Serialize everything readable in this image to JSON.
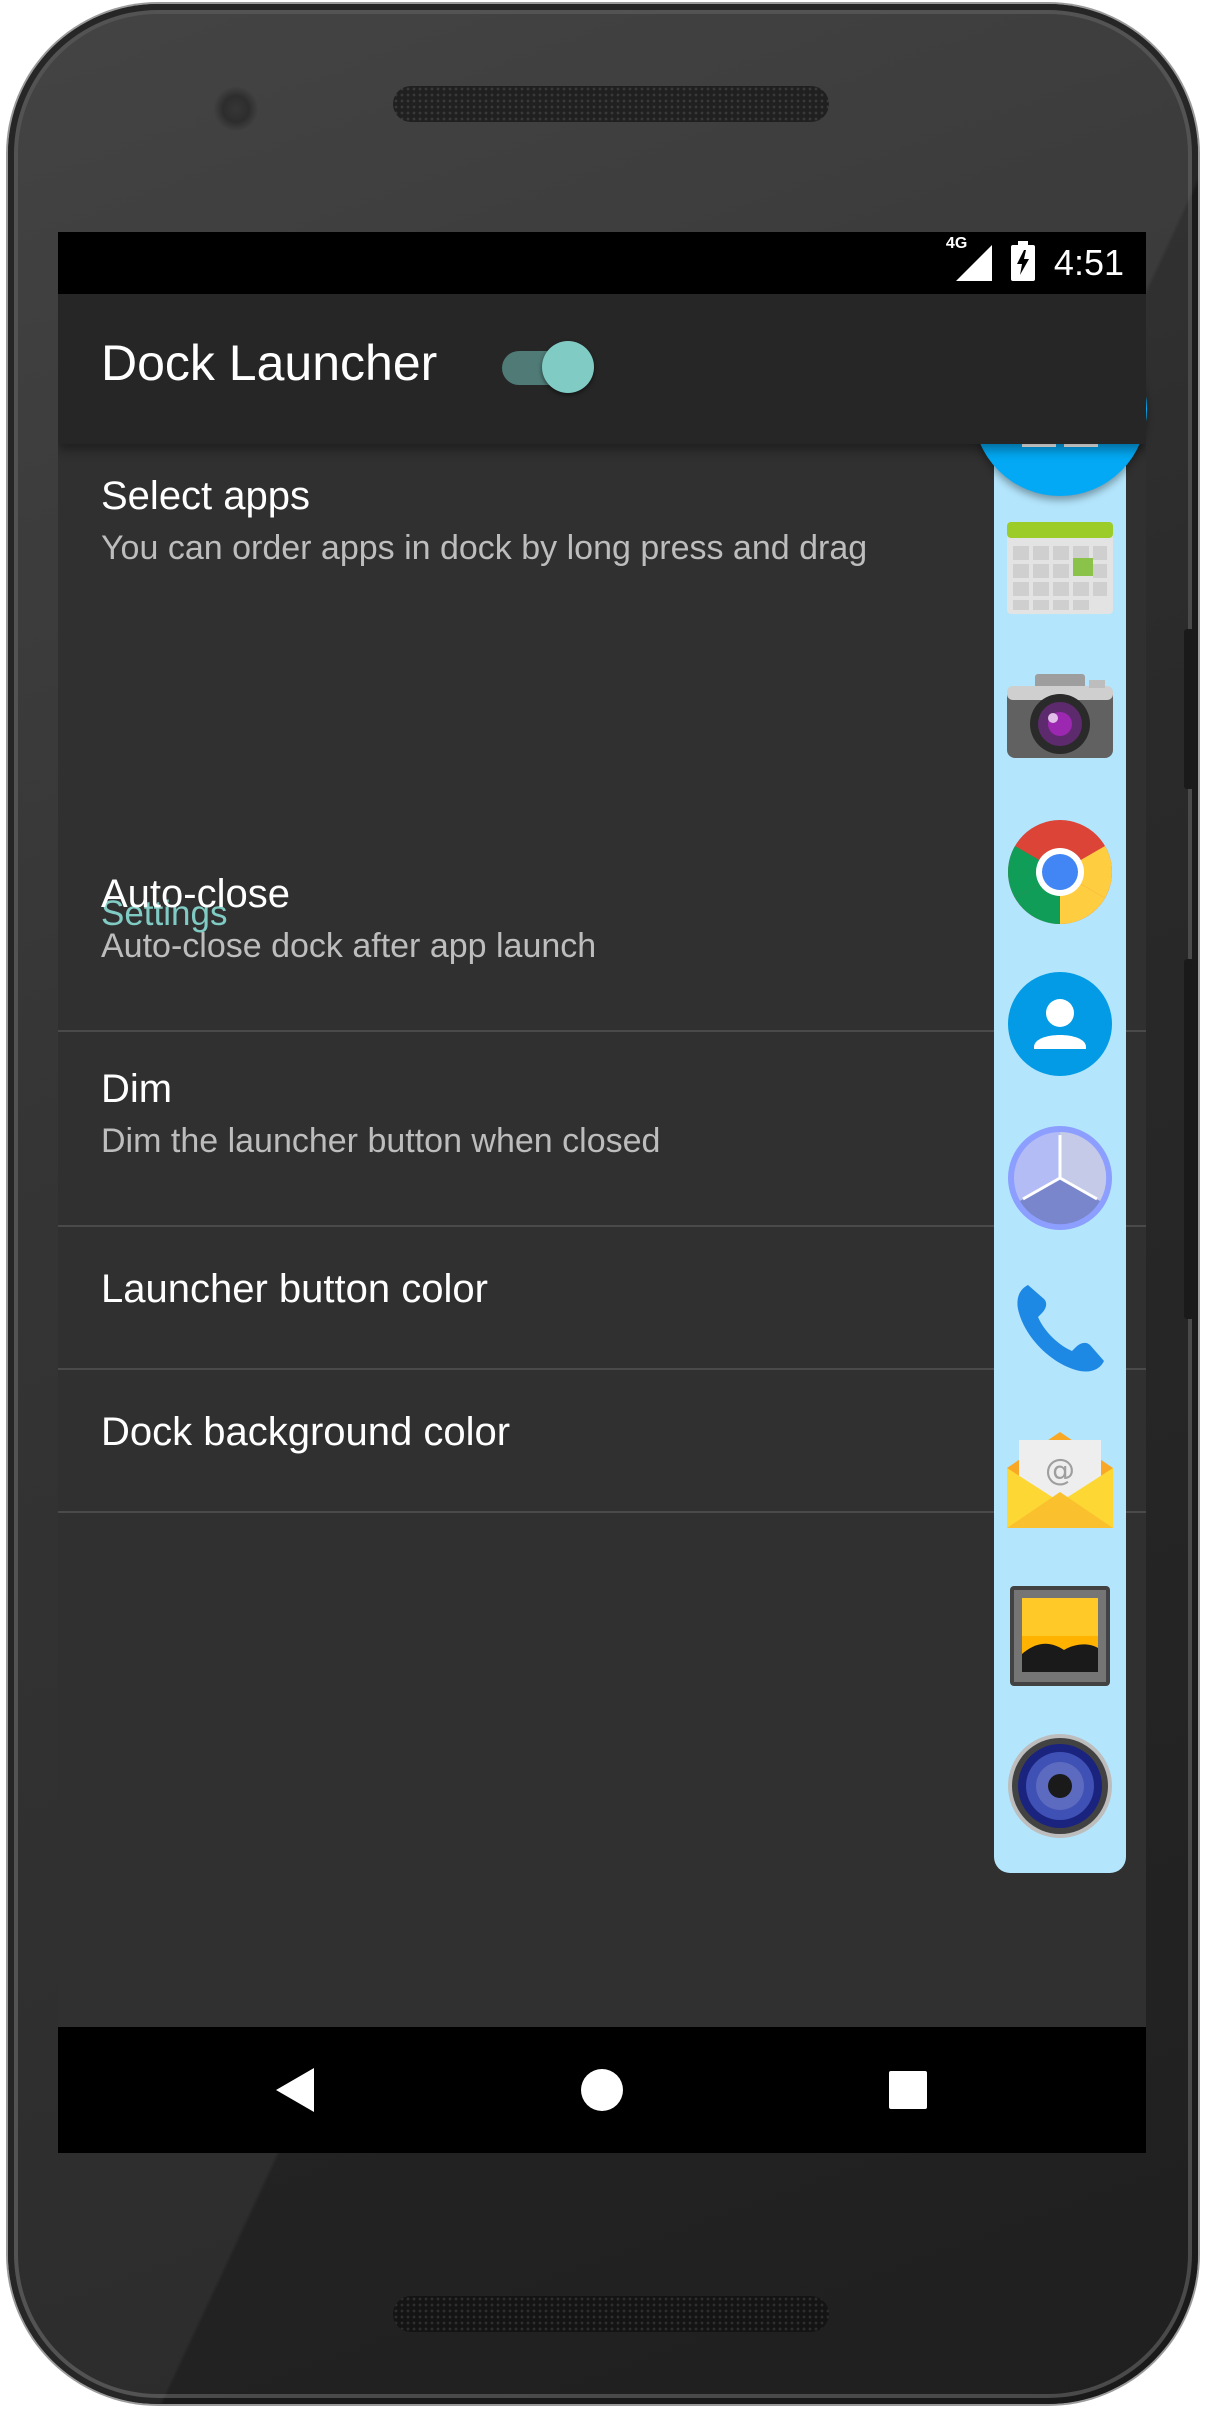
{
  "status_bar": {
    "network": "4G",
    "time": "4:51"
  },
  "app_bar": {
    "title": "Dock Launcher",
    "toggle_on": true
  },
  "preferences": {
    "select_apps": {
      "title": "Select apps",
      "summary": "You can order apps in dock by long press and drag"
    },
    "settings_category": "Settings",
    "auto_close": {
      "title": "Auto-close",
      "summary": "Auto-close dock after app launch"
    },
    "dim": {
      "title": "Dim",
      "summary": "Dim the launcher button when closed"
    },
    "launcher_button_color": {
      "title": "Launcher button color"
    },
    "dock_background_color": {
      "title": "Dock background color"
    }
  },
  "dock": {
    "launcher_color": "#03a9f4",
    "background_color": "#b3e5fc",
    "apps": [
      "calendar-icon",
      "camera-icon",
      "chrome-icon",
      "contacts-icon",
      "clock-icon",
      "phone-icon",
      "email-icon",
      "gallery-icon",
      "music-icon"
    ]
  },
  "colors": {
    "accent": "#80cbc4",
    "screen_background": "#303030"
  }
}
